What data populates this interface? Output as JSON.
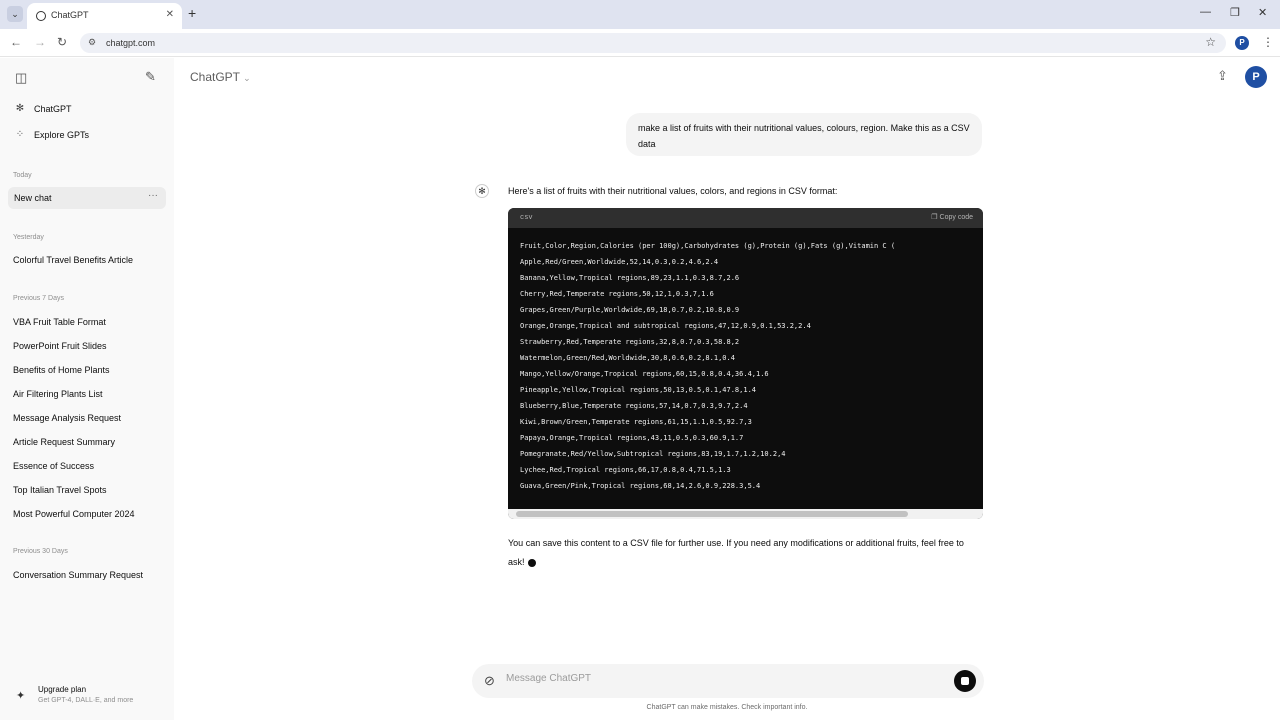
{
  "browser": {
    "tab_title": "ChatGPT",
    "url": "chatgpt.com",
    "profile_initial": "P"
  },
  "sidebar": {
    "nav": [
      {
        "label": "ChatGPT",
        "icon": "openai-logo-icon"
      },
      {
        "label": "Explore GPTs",
        "icon": "grid-icon"
      }
    ],
    "today_label": "Today",
    "active_chat": "New chat",
    "yesterday_label": "Yesterday",
    "yesterday_items": [
      "Colorful Travel Benefits Article"
    ],
    "prev7_label": "Previous 7 Days",
    "prev7_items": [
      "VBA Fruit Table Format",
      "PowerPoint Fruit Slides",
      "Benefits of Home Plants",
      "Air Filtering Plants List",
      "Message Analysis Request",
      "Article Request Summary",
      "Essence of Success",
      "Top Italian Travel Spots",
      "Most Powerful Computer 2024"
    ],
    "prev30_label": "Previous 30 Days",
    "prev30_items": [
      "Conversation Summary Request"
    ],
    "upgrade_title": "Upgrade plan",
    "upgrade_sub": "Get GPT-4, DALL·E, and more"
  },
  "header": {
    "model": "ChatGPT",
    "avatar_initial": "P"
  },
  "conversation": {
    "user_message": "make a list of fruits with their nutritional values, colours, region. Make this as a CSV data",
    "assistant_intro": "Here's a list of fruits with their nutritional values, colors, and regions in CSV format:",
    "code_lang": "csv",
    "copy_label": "Copy code",
    "code_lines": [
      "Fruit,Color,Region,Calories (per 100g),Carbohydrates (g),Protein (g),Fats (g),Vitamin C (",
      "Apple,Red/Green,Worldwide,52,14,0.3,0.2,4.6,2.4",
      "Banana,Yellow,Tropical regions,89,23,1.1,0.3,8.7,2.6",
      "Cherry,Red,Temperate regions,50,12,1,0.3,7,1.6",
      "Grapes,Green/Purple,Worldwide,69,18,0.7,0.2,10.8,0.9",
      "Orange,Orange,Tropical and subtropical regions,47,12,0.9,0.1,53.2,2.4",
      "Strawberry,Red,Temperate regions,32,8,0.7,0.3,58.8,2",
      "Watermelon,Green/Red,Worldwide,30,8,0.6,0.2,8.1,0.4",
      "Mango,Yellow/Orange,Tropical regions,60,15,0.8,0.4,36.4,1.6",
      "Pineapple,Yellow,Tropical regions,50,13,0.5,0.1,47.8,1.4",
      "Blueberry,Blue,Temperate regions,57,14,0.7,0.3,9.7,2.4",
      "Kiwi,Brown/Green,Temperate regions,61,15,1.1,0.5,92.7,3",
      "Papaya,Orange,Tropical regions,43,11,0.5,0.3,60.9,1.7",
      "Pomegranate,Red/Yellow,Subtropical regions,83,19,1.7,1.2,10.2,4",
      "Lychee,Red,Tropical regions,66,17,0.8,0.4,71.5,1.3",
      "Guava,Green/Pink,Tropical regions,68,14,2.6,0.9,228.3,5.4"
    ],
    "assistant_outro": "You can save this content to a CSV file for further use. If you need any modifications or additional fruits, feel free to ask!"
  },
  "composer": {
    "placeholder": "Message ChatGPT",
    "disclaimer": "ChatGPT can make mistakes. Check important info."
  }
}
